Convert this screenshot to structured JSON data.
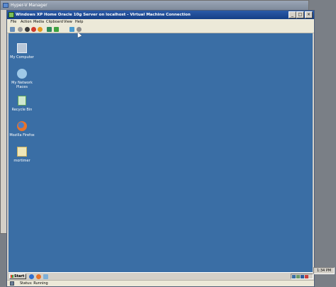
{
  "hyperv_manager": {
    "title": "Hyper-V Manager"
  },
  "vm_window": {
    "title": "Windows XP Home Oracle 10g Server on localhost - Virtual Machine Connection",
    "controls": {
      "minimize": "_",
      "maximize": "□",
      "close": "×"
    },
    "menu": [
      "File",
      "Action",
      "Media",
      "Clipboard",
      "View",
      "Help"
    ],
    "toolbar_icons": [
      "ctrl-alt-del-icon",
      "start-icon",
      "turn-off-icon",
      "shutdown-icon",
      "save-icon",
      "pause-icon",
      "reset-icon",
      "snapshot-icon",
      "revert-icon"
    ],
    "status": "Status: Running"
  },
  "desktop": {
    "background_color": "#3a6ea5",
    "icons": [
      {
        "label": "My Computer",
        "icon": "my-computer-icon"
      },
      {
        "label": "My Network Places",
        "icon": "network-places-icon"
      },
      {
        "label": "Recycle Bin",
        "icon": "recycle-bin-icon"
      },
      {
        "label": "Mozilla Firefox",
        "icon": "firefox-icon"
      },
      {
        "label": "mortimer",
        "icon": "user-folder-icon"
      }
    ]
  },
  "taskbar": {
    "start_label": "Start",
    "clock": "1:34 PM"
  }
}
